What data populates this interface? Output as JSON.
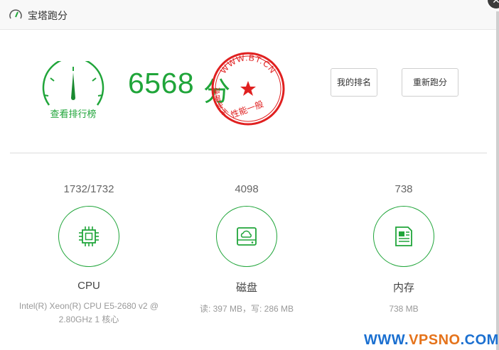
{
  "window": {
    "title": "宝塔跑分"
  },
  "gauge": {
    "link_label": "查看排行榜"
  },
  "score": {
    "value": "6568",
    "unit": "分"
  },
  "stamp": {
    "top_text": "WWW.BT.CN",
    "left_text": "宝塔面板",
    "bottom_text": "性能一般"
  },
  "buttons": {
    "rank": "我的排名",
    "rerun": "重新跑分"
  },
  "metrics": [
    {
      "value": "1732/1732",
      "name": "CPU",
      "detail": "Intel(R) Xeon(R) CPU E5-2680 v2 @ 2.80GHz 1 核心",
      "icon": "cpu-chip-icon"
    },
    {
      "value": "4098",
      "name": "磁盘",
      "detail": "读: 397 MB，写: 286 MB",
      "icon": "disk-cloud-icon"
    },
    {
      "value": "738",
      "name": "内存",
      "detail": "738 MB",
      "icon": "memory-card-icon"
    }
  ],
  "watermark": {
    "part1": "WWW.",
    "part2": "VPSNO",
    "part3": ".COM"
  },
  "colors": {
    "accent": "#20a53a",
    "stamp": "#e02020",
    "watermark_blue": "#1a6fd0",
    "watermark_orange": "#e5731b"
  }
}
